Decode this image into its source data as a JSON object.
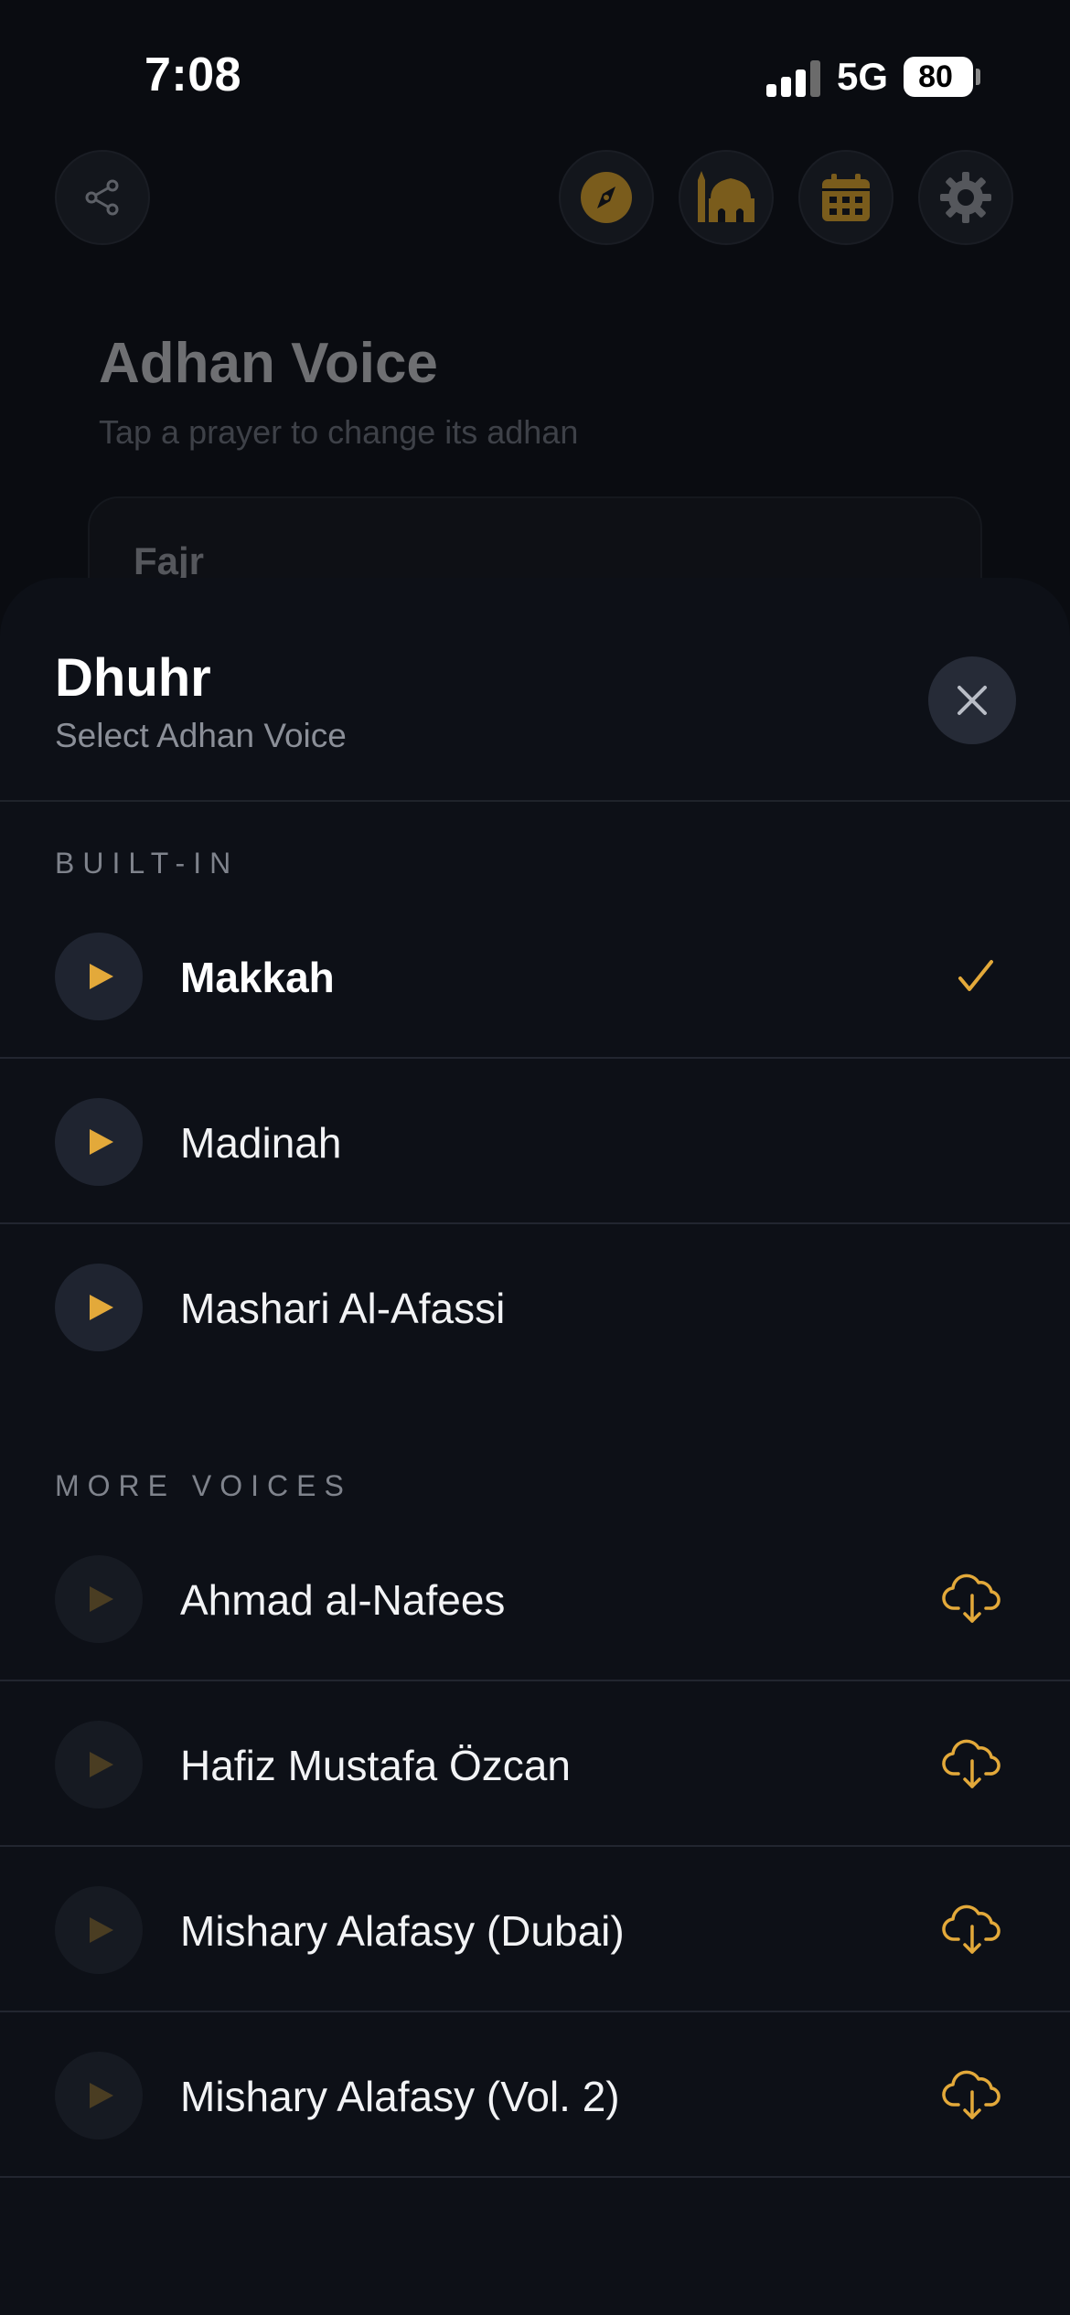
{
  "status_bar": {
    "time": "7:08",
    "network": "5G",
    "battery": "80"
  },
  "background": {
    "title": "Adhan Voice",
    "subtitle": "Tap a prayer to change its adhan",
    "first_prayer": "Fajr",
    "toolbar_icons": [
      "share-icon",
      "compass-icon",
      "mosque-icon",
      "calendar-icon",
      "settings-icon"
    ]
  },
  "sheet": {
    "title": "Dhuhr",
    "subtitle": "Select Adhan Voice",
    "close_icon": "close-icon",
    "accent_color": "#e3a93a",
    "sections": [
      {
        "label": "BUILT-IN",
        "items": [
          {
            "name": "Makkah",
            "selected": true,
            "trailing": "check-icon",
            "available": true
          },
          {
            "name": "Madinah",
            "selected": false,
            "trailing": "",
            "available": true
          },
          {
            "name": "Mashari Al-Afassi",
            "selected": false,
            "trailing": "",
            "available": true
          }
        ]
      },
      {
        "label": "MORE VOICES",
        "items": [
          {
            "name": "Ahmad al-Nafees",
            "selected": false,
            "trailing": "download-cloud-icon",
            "available": false
          },
          {
            "name": "Hafiz Mustafa Özcan",
            "selected": false,
            "trailing": "download-cloud-icon",
            "available": false
          },
          {
            "name": "Mishary Alafasy (Dubai)",
            "selected": false,
            "trailing": "download-cloud-icon",
            "available": false
          },
          {
            "name": "Mishary Alafasy (Vol. 2)",
            "selected": false,
            "trailing": "download-cloud-icon",
            "available": false
          }
        ]
      }
    ]
  }
}
